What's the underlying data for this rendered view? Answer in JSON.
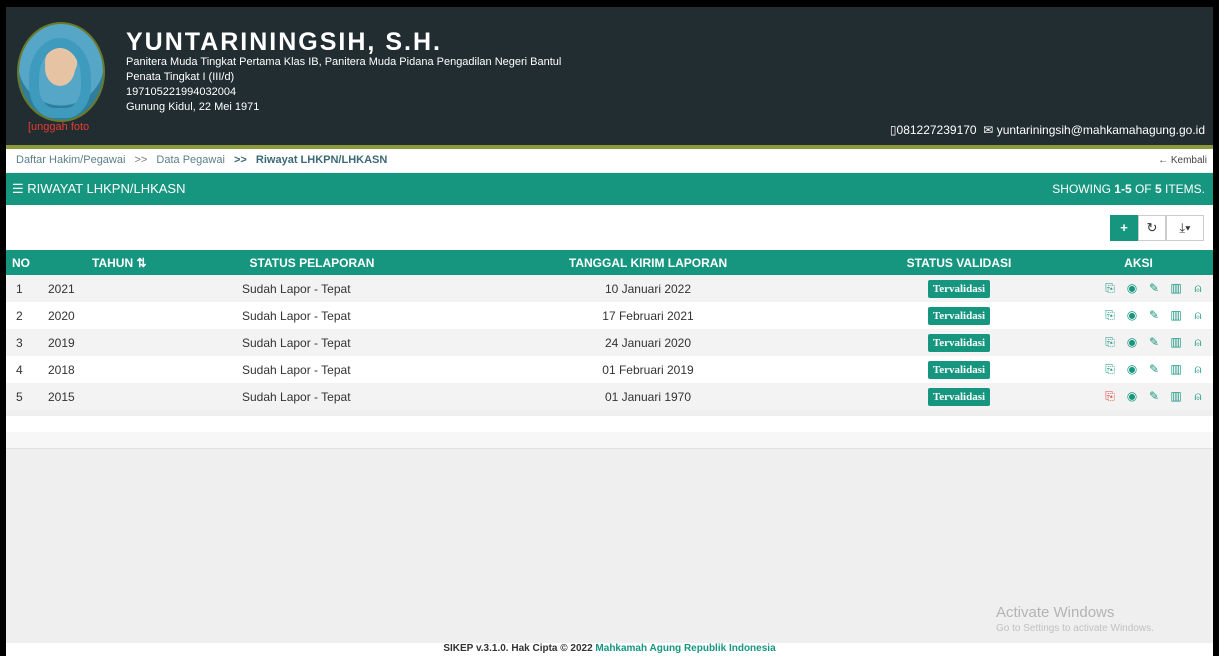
{
  "profile": {
    "name": "YUNTARININGSIH, S.H.",
    "position": "Panitera Muda Tingkat Pertama Klas IB, Panitera Muda Pidana Pengadilan Negeri Bantul",
    "rank": "Penata Tingkat I (III/d)",
    "nip": "197105221994032004",
    "birth": "Gunung Kidul, 22 Mei 1971",
    "upload_label": "[unggah foto",
    "phone": "081227239170",
    "email": "yuntariningsih@mahkamahagung.go.id"
  },
  "breadcrumb": {
    "items": [
      "Daftar Hakim/Pegawai",
      "Data Pegawai",
      "Riwayat LHKPN/LHKASN"
    ],
    "separator": ">>",
    "back_label": "Kembali"
  },
  "panel": {
    "title": "RIWAYAT LHKPN/LHKASN",
    "showing_prefix": "SHOWING ",
    "showing_range": "1-5",
    "showing_mid": " OF ",
    "showing_total": "5",
    "showing_suffix": " ITEMS."
  },
  "table": {
    "headers": {
      "no": "NO",
      "tahun": "TAHUN",
      "status": "STATUS PELAPORAN",
      "tanggal": "TANGGAL KIRIM LAPORAN",
      "validasi": "STATUS VALIDASI",
      "aksi": "AKSI"
    },
    "rows": [
      {
        "no": "1",
        "tahun": "2021",
        "status": "Sudah Lapor - Tepat",
        "tanggal": "10 Januari 2022",
        "validasi": "Tervalidasi",
        "pdf_state": "normal"
      },
      {
        "no": "2",
        "tahun": "2020",
        "status": "Sudah Lapor - Tepat",
        "tanggal": "17 Februari 2021",
        "validasi": "Tervalidasi",
        "pdf_state": "normal"
      },
      {
        "no": "3",
        "tahun": "2019",
        "status": "Sudah Lapor - Tepat",
        "tanggal": "24 Januari 2020",
        "validasi": "Tervalidasi",
        "pdf_state": "normal"
      },
      {
        "no": "4",
        "tahun": "2018",
        "status": "Sudah Lapor - Tepat",
        "tanggal": "01 Februari 2019",
        "validasi": "Tervalidasi",
        "pdf_state": "normal"
      },
      {
        "no": "5",
        "tahun": "2015",
        "status": "Sudah Lapor - Tepat",
        "tanggal": "01 Januari 1970",
        "validasi": "Tervalidasi",
        "pdf_state": "missing"
      }
    ]
  },
  "watermark": {
    "line1": "Activate Windows",
    "line2": "Go to Settings to activate Windows."
  },
  "footer": {
    "text": "SIKEP v.3.1.0. Hak Cipta © 2022 ",
    "org": "Mahkamah Agung Republik Indonesia"
  },
  "icons": {
    "pdf": "pdf-icon",
    "view": "eye-icon",
    "edit": "pencil-icon",
    "delete": "trash-icon",
    "access": "lock-icon"
  },
  "colors": {
    "primary": "#16967f",
    "header_bg": "#222d32",
    "danger": "#e33b3b"
  }
}
